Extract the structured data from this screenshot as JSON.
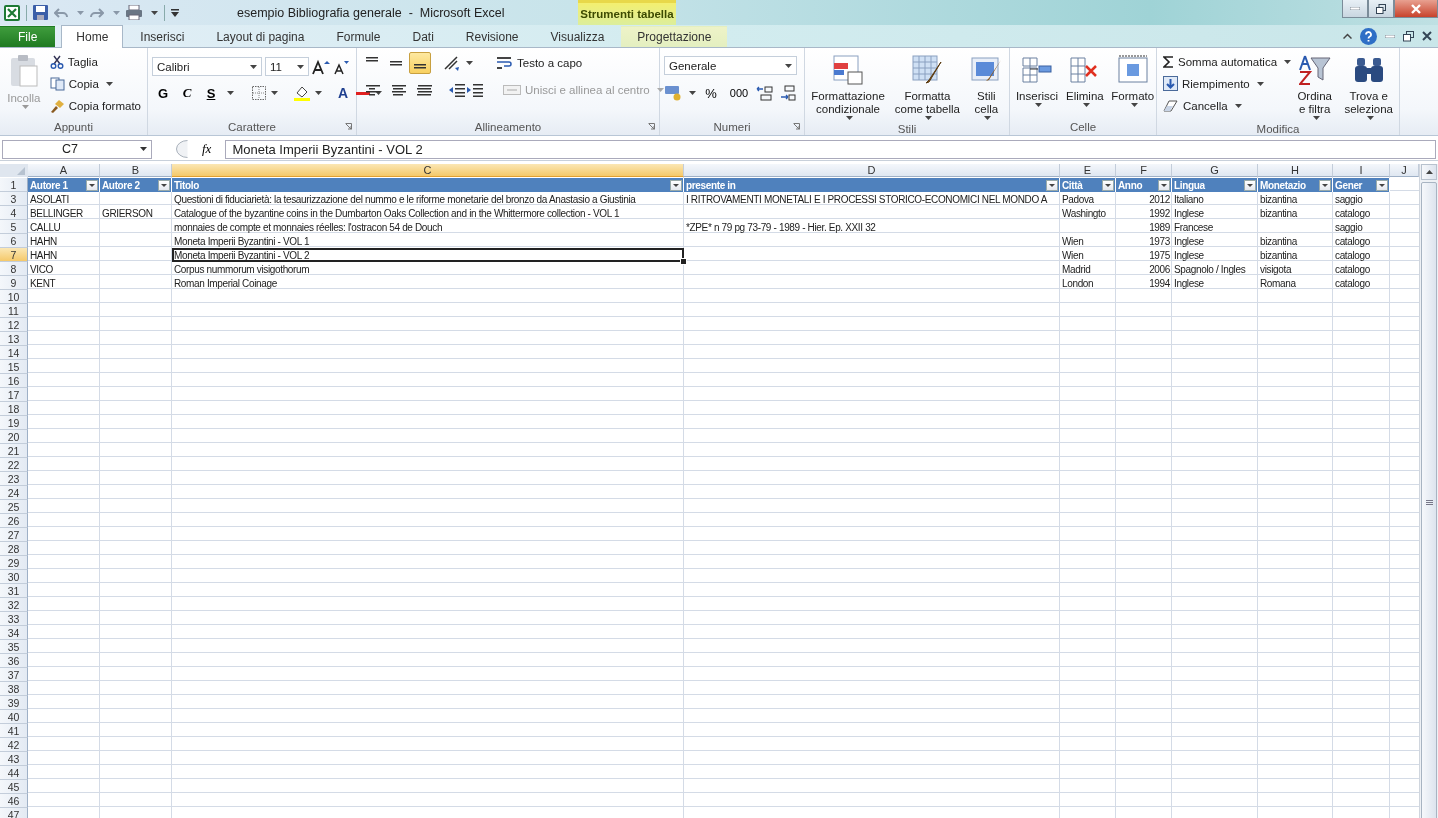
{
  "title_bar": {
    "title": "esempio Bibliografia generale  -  Microsoft Excel",
    "contextual_tab": "Strumenti tabella"
  },
  "tabs": [
    {
      "label": "File",
      "kind": "file",
      "selected": false
    },
    {
      "label": "Home",
      "kind": "tab",
      "selected": true
    },
    {
      "label": "Inserisci",
      "kind": "tab",
      "selected": false
    },
    {
      "label": "Layout di pagina",
      "kind": "tab",
      "selected": false
    },
    {
      "label": "Formule",
      "kind": "tab",
      "selected": false
    },
    {
      "label": "Dati",
      "kind": "tab",
      "selected": false
    },
    {
      "label": "Revisione",
      "kind": "tab",
      "selected": false
    },
    {
      "label": "Visualizza",
      "kind": "tab",
      "selected": false
    },
    {
      "label": "Progettazione",
      "kind": "contextual",
      "selected": false
    }
  ],
  "ribbon": {
    "clipboard": {
      "label": "Appunti",
      "paste": "Incolla",
      "paste_disabled": true,
      "cut": "Taglia",
      "copy": "Copia",
      "format_painter": "Copia formato"
    },
    "font": {
      "label": "Carattere",
      "font_name": "Calibri",
      "font_size": "11",
      "bold": "G",
      "italic": "C",
      "underline": "S",
      "font_color": "A"
    },
    "alignment": {
      "label": "Allineamento",
      "vertical_align": [
        {
          "selected": false
        },
        {
          "selected": false
        },
        {
          "selected": true
        }
      ],
      "wrap_text": "Testo a capo",
      "merge": "Unisci e allinea al centro",
      "merge_disabled": true
    },
    "number": {
      "label": "Numeri",
      "format": "Generale",
      "percent": "%",
      "thousands": "000"
    },
    "styles": {
      "label": "Stili",
      "buttons": [
        "Formattazione condizionale",
        "Formatta come tabella",
        "Stili cella"
      ]
    },
    "cells": {
      "label": "Celle",
      "buttons": [
        "Inserisci",
        "Elimina",
        "Formato"
      ]
    },
    "editing": {
      "label": "Modifica",
      "autosum": "Somma automatica",
      "fill": "Riempimento",
      "clear": "Cancella",
      "sort": "Ordina e filtra",
      "find": "Trova e seleziona"
    }
  },
  "formula_bar": {
    "name_box": "C7",
    "function_label": "fx",
    "value": "Moneta Imperii Byzantini - VOL 2"
  },
  "sheet": {
    "columns": [
      {
        "label": "A",
        "selected": false
      },
      {
        "label": "B",
        "selected": false
      },
      {
        "label": "C",
        "selected": true
      },
      {
        "label": "D",
        "selected": false
      },
      {
        "label": "E",
        "selected": false
      },
      {
        "label": "F",
        "selected": false
      },
      {
        "label": "G",
        "selected": false
      },
      {
        "label": "H",
        "selected": false
      },
      {
        "label": "I",
        "selected": false
      },
      {
        "label": "J",
        "selected": false
      }
    ],
    "header_row": "1",
    "table_headers": [
      "Autore 1",
      "Autore 2",
      "Titolo",
      "presente in",
      "Città",
      "Anno",
      "Lingua",
      "Monetazio",
      "Gener"
    ],
    "rows": [
      {
        "number": "3",
        "selected": false,
        "cells": [
          "ASOLATI",
          null,
          "Questioni di fiduciarietà: la tesaurizzazione del nummo e le riforme monetarie del bronzo da Anastasio a Giustinia",
          "I RITROVAMENTI MONETALI E I PROCESSI STORICO-ECONOMICI NEL MONDO A",
          "Padova",
          "2012",
          "Italiano",
          "bizantina",
          "saggio"
        ]
      },
      {
        "number": "4",
        "selected": false,
        "cells": [
          "BELLINGER",
          "GRIERSON",
          "Catalogue of the byzantine coins in the Dumbarton Oaks Collection and in the Whittermore collection - VOL 1",
          null,
          "Washingto",
          "1992",
          "Inglese",
          "bizantina",
          "catalogo"
        ]
      },
      {
        "number": "5",
        "selected": false,
        "cells": [
          "CALLU",
          null,
          "monnaies de compte et monnaies réelles: l'ostracon 54 de Douch",
          "*ZPE* n 79 pg 73-79 - 1989 - Hier. Ep. XXII 32",
          null,
          "1989",
          "Francese",
          null,
          "saggio"
        ]
      },
      {
        "number": "6",
        "selected": false,
        "cells": [
          "HAHN",
          null,
          "Moneta Imperii Byzantini - VOL 1",
          null,
          "Wien",
          "1973",
          "Inglese",
          "bizantina",
          "catalogo"
        ]
      },
      {
        "number": "7",
        "selected": true,
        "cells": [
          "HAHN",
          null,
          "Moneta Imperii Byzantini - VOL 2",
          null,
          "Wien",
          "1975",
          "Inglese",
          "bizantina",
          "catalogo"
        ]
      },
      {
        "number": "8",
        "selected": false,
        "cells": [
          "VICO",
          null,
          "Corpus nummorum visigothorum",
          null,
          "Madrid",
          "2006",
          "Spagnolo / Ingles",
          "visigota",
          "catalogo"
        ]
      },
      {
        "number": "9",
        "selected": false,
        "cells": [
          "KENT",
          null,
          "Roman Imperial Coinage",
          null,
          "London",
          "1994",
          "Inglese",
          "Romana",
          "catalogo"
        ]
      }
    ],
    "empty_rows": [
      "10",
      "11",
      "12",
      "13",
      "14",
      "15",
      "16",
      "17",
      "18",
      "19",
      "20",
      "21",
      "22",
      "23",
      "24",
      "25",
      "26",
      "27",
      "28",
      "29",
      "30",
      "31",
      "32",
      "33",
      "34",
      "35",
      "36",
      "37",
      "38",
      "39",
      "40",
      "41",
      "42",
      "43",
      "44",
      "45",
      "46",
      "47"
    ]
  }
}
